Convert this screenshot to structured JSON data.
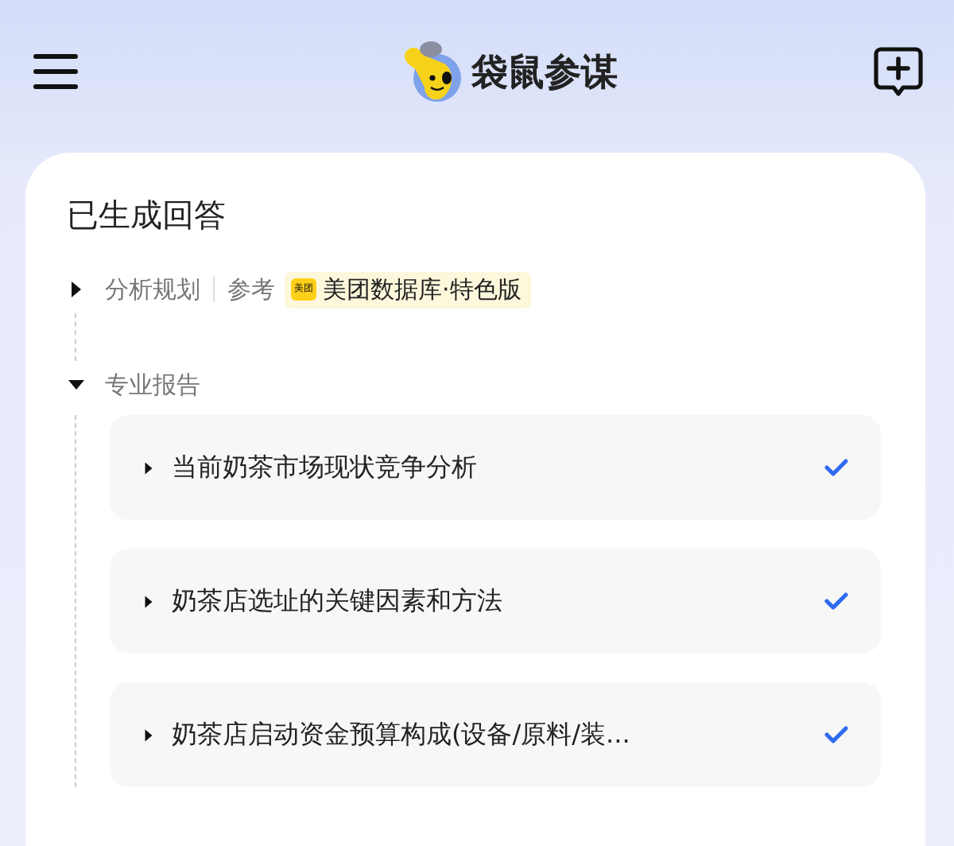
{
  "header": {
    "title": "袋鼠参谋"
  },
  "answer": {
    "title": "已生成回答",
    "steps": [
      {
        "label": "分析规划",
        "expanded": false,
        "reference": {
          "label": "参考",
          "badge": "美团",
          "source": "美团数据库·特色版"
        }
      },
      {
        "label": "专业报告",
        "expanded": true,
        "items": [
          {
            "label": "当前奶茶市场现状竞争分析",
            "expanded": false,
            "done": true
          },
          {
            "label": "奶茶店选址的关键因素和方法",
            "expanded": false,
            "done": true
          },
          {
            "label": "奶茶店启动资金预算构成(设备/原料/装...",
            "expanded": false,
            "done": true
          }
        ]
      }
    ]
  }
}
